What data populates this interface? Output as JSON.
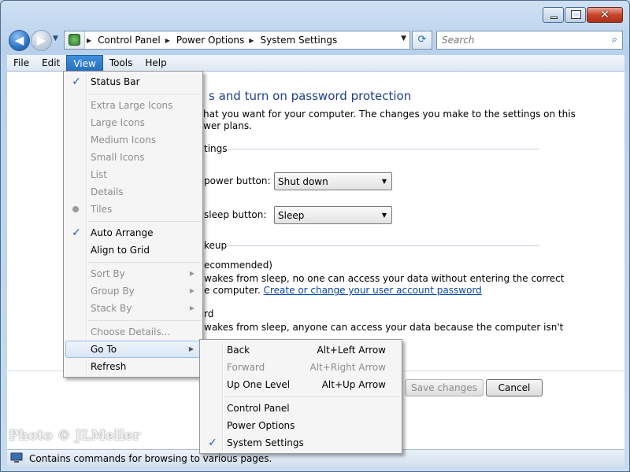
{
  "window": {
    "caption_buttons": {
      "minimize_icon": "minimize-icon",
      "maximize_icon": "maximize-icon",
      "close_icon": "close-icon"
    }
  },
  "navigation": {
    "back_glyph": "◀",
    "forward_glyph": "▶",
    "breadcrumbs": [
      "Control Panel",
      "Power Options",
      "System Settings"
    ],
    "refresh_glyph": "⟳",
    "search_placeholder": "Search",
    "search_glyph": "⌕"
  },
  "menubar": {
    "items": [
      "File",
      "Edit",
      "View",
      "Tools",
      "Help"
    ],
    "active": "View"
  },
  "content": {
    "heading_fragment": "s and turn on password protection",
    "description_lines": [
      "hat you want for your computer. The changes you make to the settings on this",
      "wer plans."
    ],
    "section1_fragment": "tings",
    "power_button_label_fragment": "power button:",
    "power_button_value": "Shut down",
    "sleep_button_label_fragment": "sleep button:",
    "sleep_button_value": "Sleep",
    "section2_fragment": "keup",
    "option1_title_fragment": "ecommended)",
    "option1_line1": "wakes from sleep, no one can access your data without entering the correct",
    "option1_line2_prefix": "e computer.",
    "option1_link": "Create or change your user account password",
    "option2_title_fragment": "rd",
    "option2_line1": "wakes from sleep, anyone can access your data because the computer isn't",
    "save_button": "Save changes",
    "cancel_button": "Cancel"
  },
  "view_menu": {
    "items": [
      {
        "label": "Status Bar",
        "checked": true
      },
      {
        "label": "Extra Large Icons",
        "disabled": true
      },
      {
        "label": "Large Icons",
        "disabled": true
      },
      {
        "label": "Medium Icons",
        "disabled": true
      },
      {
        "label": "Small Icons",
        "disabled": true
      },
      {
        "label": "List",
        "disabled": true
      },
      {
        "label": "Details",
        "disabled": true
      },
      {
        "label": "Tiles",
        "disabled": true,
        "bullet": true
      },
      {
        "label": "Auto Arrange",
        "checked": true
      },
      {
        "label": "Align to Grid"
      },
      {
        "label": "Sort By",
        "disabled": true,
        "submenu": true
      },
      {
        "label": "Group By",
        "disabled": true,
        "submenu": true
      },
      {
        "label": "Stack By",
        "disabled": true,
        "submenu": true
      },
      {
        "label": "Choose Details...",
        "disabled": true
      },
      {
        "label": "Go To",
        "submenu": true,
        "highlighted": true
      },
      {
        "label": "Refresh"
      }
    ]
  },
  "goto_menu": {
    "items": [
      {
        "label": "Back",
        "shortcut": "Alt+Left Arrow"
      },
      {
        "label": "Forward",
        "shortcut": "Alt+Right Arrow",
        "disabled": true
      },
      {
        "label": "Up One Level",
        "shortcut": "Alt+Up Arrow"
      },
      {
        "label": "Control Panel"
      },
      {
        "label": "Power Options"
      },
      {
        "label": "System Settings",
        "checked": true
      }
    ]
  },
  "statusbar": {
    "text": "Contains commands for browsing to various pages."
  },
  "watermark": "Photo © JLMeller",
  "glyphs": {
    "check": "✓",
    "submenu_arrow": "▶",
    "dropdown_arrow": "▼",
    "crumb_sep": "▶"
  }
}
